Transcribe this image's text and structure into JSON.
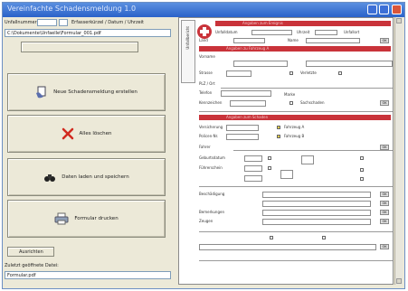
{
  "window": {
    "title": "Vereinfachte Schadensmeldung 1.0",
    "accent": "#2a62c9",
    "form_accent": "#c9333a"
  },
  "left": {
    "top_label": "Unfallnummer:",
    "top_right_label": "Erfasserkürzel / Datum / Uhrzeit",
    "path_value": "C:\\Dokumente\\Unfaelle\\Formular_001.pdf",
    "buttons": [
      {
        "label": "Neue Schadensmeldung erstellen",
        "icon": "hand-form-icon"
      },
      {
        "label": "Alles löschen",
        "icon": "red-x-icon"
      },
      {
        "label": "Daten laden und speichern",
        "icon": "binoculars-icon"
      },
      {
        "label": "Formular drucken",
        "icon": "printer-icon"
      }
    ],
    "small_button": "Ausrichten",
    "footer_label": "Zuletzt geöffnete Datei:",
    "footer_value": "Formular.pdf"
  },
  "form": {
    "side_tab": "Unfallbericht",
    "bar1": "Angaben zum Ereignis",
    "bar2": "Angaben zu Fahrzeug A",
    "bar3": "Angaben zum Schaden",
    "labels": [
      "Unfalldatum",
      "Uhrzeit",
      "Unfallort",
      "Land",
      "Name",
      "Vorname",
      "Strasse",
      "PLZ / Ort",
      "Telefon",
      "Marke",
      "Kennzeichen",
      "Versicherung",
      "Policen-Nr.",
      "Fahrer",
      "Geburtsdatum",
      "Führerschein",
      "Beschädigung",
      "Bemerkungen",
      "Zeugen"
    ],
    "checkbox_labels": [
      "Verletzte",
      "Sachschaden",
      "Fahrzeug A",
      "Fahrzeug B"
    ]
  }
}
